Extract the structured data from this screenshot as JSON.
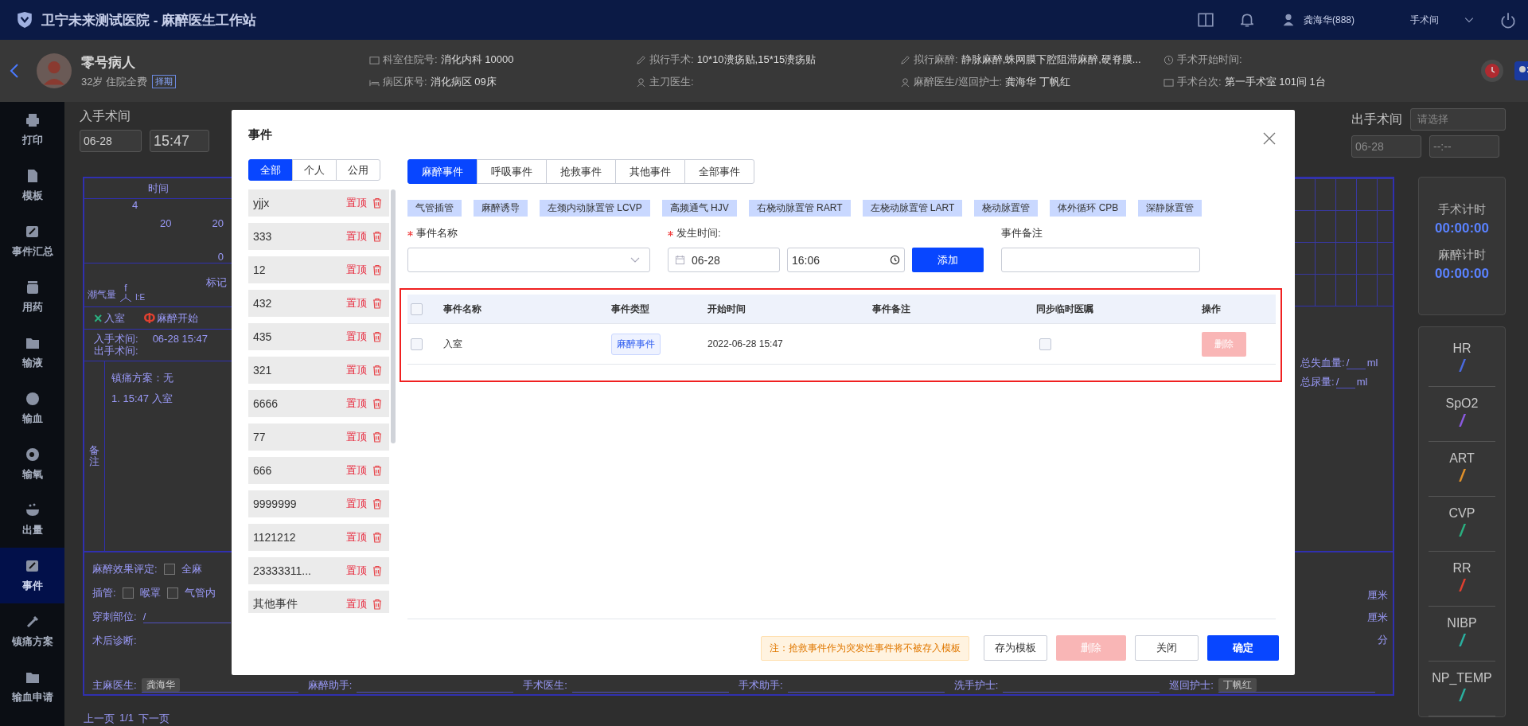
{
  "header": {
    "title": "卫宁未来测试医院 - 麻醉医生工作站",
    "user": "龚海华(888)",
    "room": "手术间"
  },
  "patient": {
    "name": "零号病人",
    "info": "32岁 住院全费",
    "badge": "择期",
    "fields": [
      {
        "label": "科室住院号:",
        "value": "消化内科 10000"
      },
      {
        "label": "病区床号:",
        "value": "消化病区 09床"
      },
      {
        "label": "拟行手术:",
        "value": "10*10溃疡贴,15*15溃疡贴"
      },
      {
        "label": "主刀医生:"
      },
      {
        "label": "拟行麻醉:",
        "value": "静脉麻醉,蛛网膜下腔阻滞麻醉,硬脊膜..."
      },
      {
        "label": "麻醉医生/巡回护士:",
        "value": "龚海华 丁帆红"
      },
      {
        "label": "手术开始时间:"
      },
      {
        "label": "手术台次:",
        "value": "第一手术室 101间 1台"
      }
    ]
  },
  "sidebar": {
    "items": [
      {
        "label": "打印",
        "selected": false
      },
      {
        "label": "模板",
        "selected": false
      },
      {
        "label": "事件汇总",
        "selected": false
      },
      {
        "label": "用药",
        "selected": false
      },
      {
        "label": "输液",
        "selected": false
      },
      {
        "label": "输血",
        "selected": false
      },
      {
        "label": "输氧",
        "selected": false
      },
      {
        "label": "出量",
        "selected": false
      },
      {
        "label": "事件",
        "selected": true
      },
      {
        "label": "镇痛方案",
        "selected": false
      },
      {
        "label": "输血申请",
        "selected": false
      }
    ]
  },
  "room_times": {
    "enter": {
      "label": "入手术间",
      "date": "06-28",
      "time": "15:47"
    },
    "exit": {
      "label": "出手术间",
      "select_placeholder": "请选择",
      "date_placeholder": "06-28",
      "time_placeholder": "--:--"
    }
  },
  "record_form": {
    "time_header": "时间",
    "axis_labels": [
      "4",
      "20",
      "20",
      "0"
    ],
    "flow_label": "f",
    "tidal_label": "潮气量",
    "ie_label": "I:E",
    "mark_label": "标记",
    "legend": [
      {
        "symbol": "×",
        "label": "入室",
        "color": "#2ab080"
      },
      {
        "symbol": "Φ",
        "label": "麻醉开始",
        "color": "#e04030"
      }
    ],
    "enter_label": "入手术间:",
    "enter_value": "06-28 15:47",
    "exit_label": "出手术间:",
    "notes_label": "备注",
    "notes": [
      "镇痛方案：无",
      "1. 15:47 入室"
    ],
    "assessment_label": "麻醉效果评定:",
    "assessment_options": [
      {
        "label": "全麻",
        "checked": false
      }
    ],
    "intubation_label": "插管:",
    "intubation_options": [
      {
        "label": "喉罩",
        "checked": false
      },
      {
        "label": "气管内",
        "checked": false
      }
    ],
    "puncture_label": "穿刺部位:",
    "puncture_value": "/",
    "diagnosis_label": "术后诊断:",
    "totals": [
      {
        "label": "总失血量:",
        "value": "/",
        "unit": "ml"
      },
      {
        "label": "总尿量:",
        "value": "/",
        "unit": "ml"
      }
    ],
    "units": [
      "厘米",
      "厘米",
      "分"
    ],
    "staff": [
      {
        "label": "主麻医生:",
        "value": "龚海华"
      },
      {
        "label": "麻醉助手:"
      },
      {
        "label": "手术医生:"
      },
      {
        "label": "手术助手:"
      },
      {
        "label": "洗手护士:"
      },
      {
        "label": "巡回护士:",
        "value": "丁帆红"
      }
    ]
  },
  "pager": {
    "prev": "上一页",
    "page": "1/1",
    "next": "下一页"
  },
  "vitals_panel": {
    "timers": [
      {
        "label": "手术计时",
        "value": "00:00:00"
      },
      {
        "label": "麻醉计时",
        "value": "00:00:00"
      }
    ],
    "signs": [
      {
        "name": "HR",
        "value": "/",
        "color": "#4a6ae0"
      },
      {
        "name": "SpO2",
        "value": "/",
        "color": "#8a5ae0"
      },
      {
        "name": "ART",
        "value": "/",
        "color": "#e0902a"
      },
      {
        "name": "CVP",
        "value": "/",
        "color": "#2ab080"
      },
      {
        "name": "RR",
        "value": "/",
        "color": "#e04030"
      },
      {
        "name": "NIBP",
        "value": "/",
        "color": "#2ab0a0"
      },
      {
        "name": "NP_TEMP",
        "value": "/",
        "color": "#2ab0a0"
      }
    ]
  },
  "dialog": {
    "title": "事件",
    "scope_tabs": [
      {
        "label": "全部",
        "selected": true
      },
      {
        "label": "个人",
        "selected": false
      },
      {
        "label": "公用",
        "selected": false
      }
    ],
    "templates": [
      {
        "name": "yjjx",
        "pin": "置顶"
      },
      {
        "name": "333",
        "pin": "置顶"
      },
      {
        "name": "12",
        "pin": "置顶"
      },
      {
        "name": "432",
        "pin": "置顶"
      },
      {
        "name": "435",
        "pin": "置顶"
      },
      {
        "name": "321",
        "pin": "置顶"
      },
      {
        "name": "6666",
        "pin": "置顶"
      },
      {
        "name": "77",
        "pin": "置顶"
      },
      {
        "name": "666",
        "pin": "置顶"
      },
      {
        "name": "9999999",
        "pin": "置顶"
      },
      {
        "name": "1121212",
        "pin": "置顶"
      },
      {
        "name": "23333311...",
        "pin": "置顶"
      },
      {
        "name": "其他事件",
        "pin": "置顶"
      }
    ],
    "type_tabs": [
      {
        "label": "麻醉事件",
        "selected": true
      },
      {
        "label": "呼吸事件",
        "selected": false
      },
      {
        "label": "抢救事件",
        "selected": false
      },
      {
        "label": "其他事件",
        "selected": false
      },
      {
        "label": "全部事件",
        "selected": false
      }
    ],
    "quick_tags": [
      "气管插管",
      "麻醉诱导",
      "左颈内动脉置管 LCVP",
      "高频通气 HJV",
      "右桡动脉置管 RART",
      "左桡动脉置管 LART",
      "桡动脉置管",
      "体外循环 CPB",
      "深静脉置管"
    ],
    "name_field": {
      "label": "事件名称",
      "required": true
    },
    "time_field": {
      "label": "发生时间:",
      "required": true,
      "date": "06-28",
      "time": "16:06"
    },
    "add_button": "添加",
    "remark_field": {
      "label": "事件备注",
      "required": false
    },
    "table": {
      "columns": [
        "事件名称",
        "事件类型",
        "开始时间",
        "事件备注",
        "同步临时医嘱",
        "操作"
      ],
      "all_checked": false,
      "rows": [
        {
          "checked": false,
          "name": "入室",
          "type": "麻醉事件",
          "start": "2022-06-28 15:47",
          "sync": false,
          "action": "删除",
          "disabled": true
        }
      ]
    },
    "note": "注：抢救事件作为突发性事件将不被存入模板",
    "buttons": [
      {
        "label": "存为模板",
        "kind": "default",
        "disabled": false
      },
      {
        "label": "删除",
        "kind": "danger",
        "disabled": true
      },
      {
        "label": "关闭",
        "kind": "default",
        "disabled": false
      },
      {
        "label": "确定",
        "kind": "primary",
        "disabled": false
      }
    ]
  }
}
